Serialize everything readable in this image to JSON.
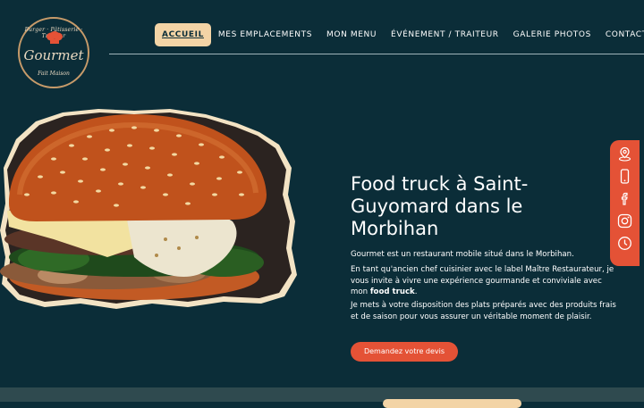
{
  "logo": {
    "top_text": "Burger · Pâtisserie · Traiteur",
    "brand": "Gourmet",
    "tagline": "Fait Maison"
  },
  "nav": {
    "items": [
      {
        "label": "ACCUEIL",
        "active": true
      },
      {
        "label": "MES EMPLACEMENTS",
        "active": false
      },
      {
        "label": "MON MENU",
        "active": false
      },
      {
        "label": "ÉVÉNEMENT / TRAITEUR",
        "active": false
      },
      {
        "label": "GALERIE PHOTOS",
        "active": false
      },
      {
        "label": "CONTACT",
        "active": false
      }
    ]
  },
  "hero": {
    "title": "Food truck à Saint-Guyomard dans le Morbihan",
    "p1": "Gourmet est un restaurant mobile situé dans le Morbihan.",
    "p2_before": "En tant qu'ancien chef cuisinier avec le label Maître Restaurateur, je vous invite à vivre une expérience gourmande et conviviale avec mon ",
    "p2_bold": "food truck",
    "p2_after": ".",
    "p3": "Je mets à votre disposition des plats préparés avec des produits frais et de saison pour vous assurer un véritable moment de plaisir.",
    "cta": "Demandez votre devis"
  },
  "social": {
    "icons": [
      "location-icon",
      "phone-icon",
      "facebook-icon",
      "instagram-icon",
      "clock-icon"
    ]
  },
  "colors": {
    "background": "#0b2d38",
    "accent": "#e45236",
    "nav_active": "#f3d4a6",
    "logo_border": "#c79b6a"
  }
}
